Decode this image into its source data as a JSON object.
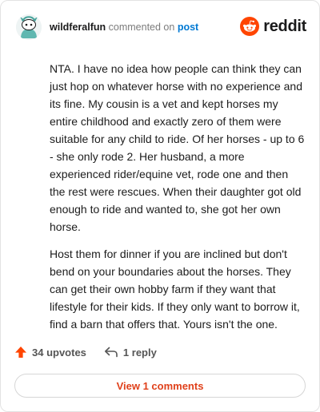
{
  "header": {
    "username": "wildferalfun",
    "commented_on": "commented on",
    "post_link": "post"
  },
  "brand": {
    "wordmark": "reddit",
    "accent_color": "#ff4500"
  },
  "comment": {
    "paragraphs": [
      "NTA. I have no idea how people can think they can just hop on whatever horse with no experience and its fine. My cousin is a vet and kept horses my entire childhood and exactly zero of them were suitable for any child to ride. Of her horses - up to 6 - she only rode 2. Her husband, a more experienced rider/equine vet, rode one and then the rest were rescues. When their daughter got old enough to ride and wanted to, she got her own horse.",
      "Host them for dinner if you are inclined but don't bend on your boundaries about the horses. They can get their own hobby farm if they want that lifestyle for their kids. If they only want to borrow it, find a barn that offers that. Yours isn't the one."
    ]
  },
  "actions": {
    "upvotes_label": "34 upvotes",
    "reply_label": "1 reply",
    "upvote_icon": "upvote-arrow-icon",
    "reply_icon": "reply-arrow-icon"
  },
  "footer": {
    "view_comments_label": "View 1 comments"
  }
}
